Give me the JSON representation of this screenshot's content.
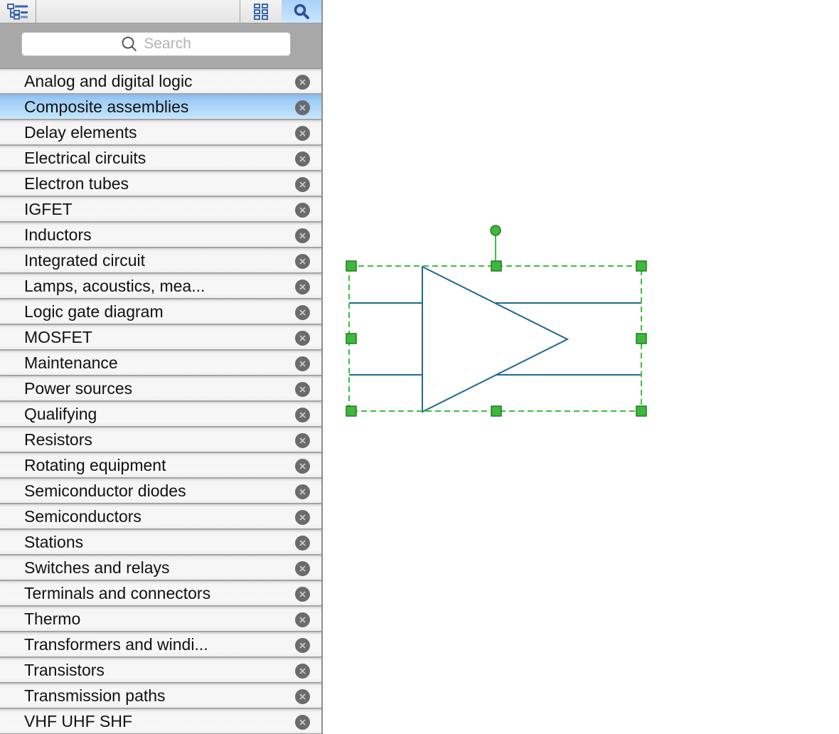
{
  "toolbar": {
    "buttons": [
      {
        "name": "tree-view",
        "icon": "tree-list-icon",
        "active": false
      },
      {
        "name": "grid-view",
        "icon": "grid-icon",
        "active": false
      },
      {
        "name": "search-view",
        "icon": "search-icon",
        "active": true
      }
    ]
  },
  "search": {
    "placeholder": "Search",
    "value": ""
  },
  "library": {
    "selected_index": 1,
    "items": [
      {
        "label": "Analog and digital logic"
      },
      {
        "label": "Composite assemblies"
      },
      {
        "label": "Delay elements"
      },
      {
        "label": "Electrical circuits"
      },
      {
        "label": "Electron tubes"
      },
      {
        "label": "IGFET"
      },
      {
        "label": "Inductors"
      },
      {
        "label": "Integrated circuit"
      },
      {
        "label": "Lamps, acoustics, mea..."
      },
      {
        "label": "Logic gate diagram"
      },
      {
        "label": "MOSFET"
      },
      {
        "label": "Maintenance"
      },
      {
        "label": "Power sources"
      },
      {
        "label": "Qualifying"
      },
      {
        "label": "Resistors"
      },
      {
        "label": "Rotating equipment"
      },
      {
        "label": "Semiconductor diodes"
      },
      {
        "label": "Semiconductors"
      },
      {
        "label": "Stations"
      },
      {
        "label": "Switches and relays"
      },
      {
        "label": "Terminals and connectors"
      },
      {
        "label": "Thermo"
      },
      {
        "label": "Transformers and windi..."
      },
      {
        "label": "Transistors"
      },
      {
        "label": "Transmission paths"
      },
      {
        "label": "VHF UHF SHF"
      }
    ],
    "close_icon": "close-circle-icon"
  },
  "canvas": {
    "selected_shape": {
      "type": "amplifier-symbol",
      "stroke_color": "#1e6a8c",
      "selection_color": "#3cbf3c",
      "handle_fill": "#3db83d",
      "handle_border": "#237a23"
    }
  }
}
